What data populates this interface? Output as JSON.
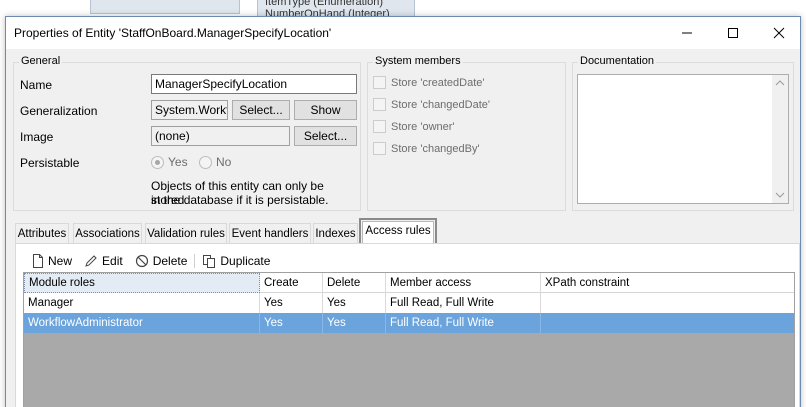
{
  "background": {
    "lines": [
      "ItemType (Enumeration)",
      "NumberOnHand (Integer)"
    ]
  },
  "window": {
    "title": "Properties of Entity 'StaffOnBoard.ManagerSpecifyLocation'"
  },
  "general": {
    "group_label": "General",
    "name_label": "Name",
    "name_value": "ManagerSpecifyLocation",
    "generalization_label": "Generalization",
    "generalization_value": "System.Workfl",
    "select_label": "Select...",
    "show_label": "Show",
    "image_label": "Image",
    "image_value": "(none)",
    "image_select_label": "Select...",
    "persistable_label": "Persistable",
    "yes_label": "Yes",
    "no_label": "No",
    "note_line1": "Objects of this entity can only be stored",
    "note_line2": "in the database if it is persistable."
  },
  "system_members": {
    "group_label": "System members",
    "items": [
      "Store 'createdDate'",
      "Store 'changedDate'",
      "Store 'owner'",
      "Store 'changedBy'"
    ]
  },
  "documentation": {
    "group_label": "Documentation",
    "value": ""
  },
  "tabs": [
    "Attributes",
    "Associations",
    "Validation rules",
    "Event handlers",
    "Indexes",
    "Access rules"
  ],
  "active_tab": "Access rules",
  "toolbar": {
    "new_label": "New",
    "edit_label": "Edit",
    "delete_label": "Delete",
    "duplicate_label": "Duplicate"
  },
  "grid": {
    "columns": [
      "Module roles",
      "Create",
      "Delete",
      "Member access",
      "XPath constraint"
    ],
    "rows": [
      [
        "Manager",
        "Yes",
        "Yes",
        "Full Read, Full Write",
        ""
      ],
      [
        "WorkflowAdministrator",
        "Yes",
        "Yes",
        "Full Read, Full Write",
        ""
      ]
    ],
    "selected_row": 1
  },
  "colors": {
    "selection": "#6ba3dc",
    "window_bg": "#f0f0f0"
  }
}
